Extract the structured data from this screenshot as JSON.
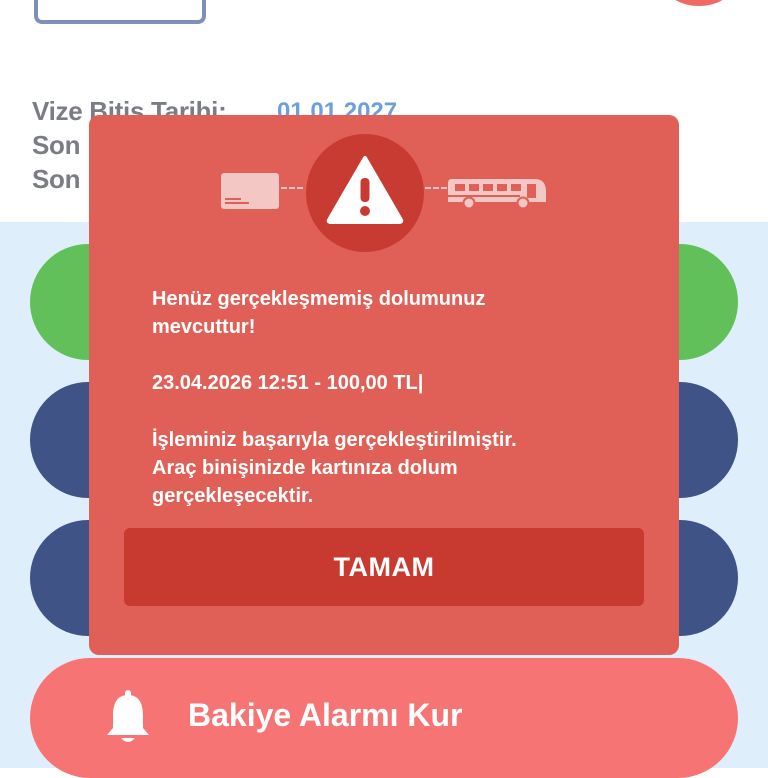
{
  "header": {
    "visa_label": "Vize Bitiş Tarihi:",
    "visa_value": "01.01.2027",
    "row2_label": "Son",
    "row3_label": "Son"
  },
  "alarm_button": {
    "label": "Bakiye Alarmı Kur",
    "icon": "bell-icon"
  },
  "dialog": {
    "icons": [
      "card-icon",
      "warning-icon",
      "bus-icon"
    ],
    "message_line1": "Henüz gerçekleşmemiş dolumunuz",
    "message_line2": "mevcuttur!",
    "transaction": "23.04.2026 12:51 - 100,00 TL|",
    "info_line1": "İşleminiz başarıyla gerçekleştirilmiştir.",
    "info_line2": "Araç binişinizde kartınıza dolum",
    "info_line3": "gerçekleşecektir.",
    "ok_label": "TAMAM"
  },
  "colors": {
    "dialog_bg": "#e06057",
    "dialog_button": "#c8392f",
    "green_pill": "#62c05a",
    "navy_pill": "#3f5387",
    "alarm_pill": "#f77474",
    "blue_bg": "#dfeefb",
    "link_blue": "#6d9fdc"
  }
}
